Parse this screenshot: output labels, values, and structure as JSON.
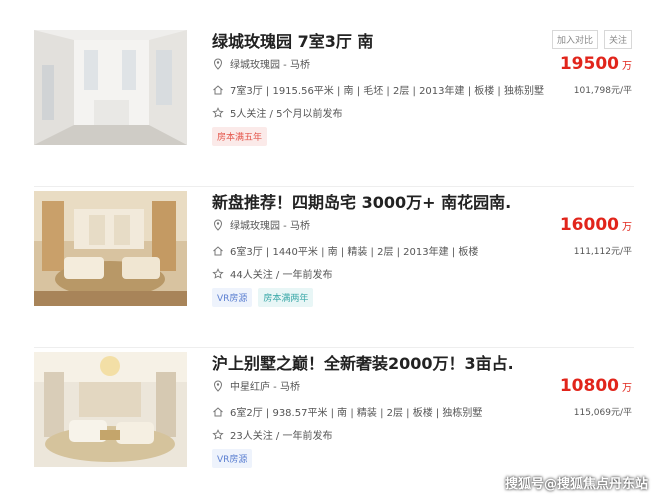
{
  "listings": [
    {
      "title": "绿城玫瑰园 7室3厅 南",
      "location": "绿城玫瑰园 - 马桥",
      "info": "7室3厅 | 1915.56平米 | 南 | 毛坯 | 2层 | 2013年建 | 板楼 | 独栋别墅",
      "follow": "5人关注 / 5个月以前发布",
      "tags": [
        {
          "label": "房本满五年",
          "style": "red"
        }
      ],
      "price": "19500",
      "price_unit": "万",
      "unit_price": "101,798元/平",
      "compare_label": "加入对比",
      "follow_button_label": "关注"
    },
    {
      "title": "新盘推荐！四期岛宅 3000万+ 南花园南...",
      "location": "绿城玫瑰园 - 马桥",
      "info": "6室3厅 | 1440平米 | 南 | 精装 | 2层 | 2013年建 | 板楼",
      "follow": "44人关注 / 一年前发布",
      "tags": [
        {
          "label": "VR房源",
          "style": "blue"
        },
        {
          "label": "房本满两年",
          "style": "teal"
        }
      ],
      "price": "16000",
      "price_unit": "万",
      "unit_price": "111,112元/平"
    },
    {
      "title": "沪上别墅之巅！全新奢装2000万！3亩占...",
      "location": "中星红庐 - 马桥",
      "info": "6室2厅 | 938.57平米 | 南 | 精装 | 2层 | 板楼 | 独栋别墅",
      "follow": "23人关注 / 一年前发布",
      "tags": [
        {
          "label": "VR房源",
          "style": "blue"
        }
      ],
      "price": "10800",
      "price_unit": "万",
      "unit_price": "115,069元/平"
    }
  ],
  "icons": {
    "location": "location-pin-icon",
    "house": "house-icon",
    "star": "star-icon"
  },
  "watermark": "搜狐号@搜狐焦点丹东站"
}
